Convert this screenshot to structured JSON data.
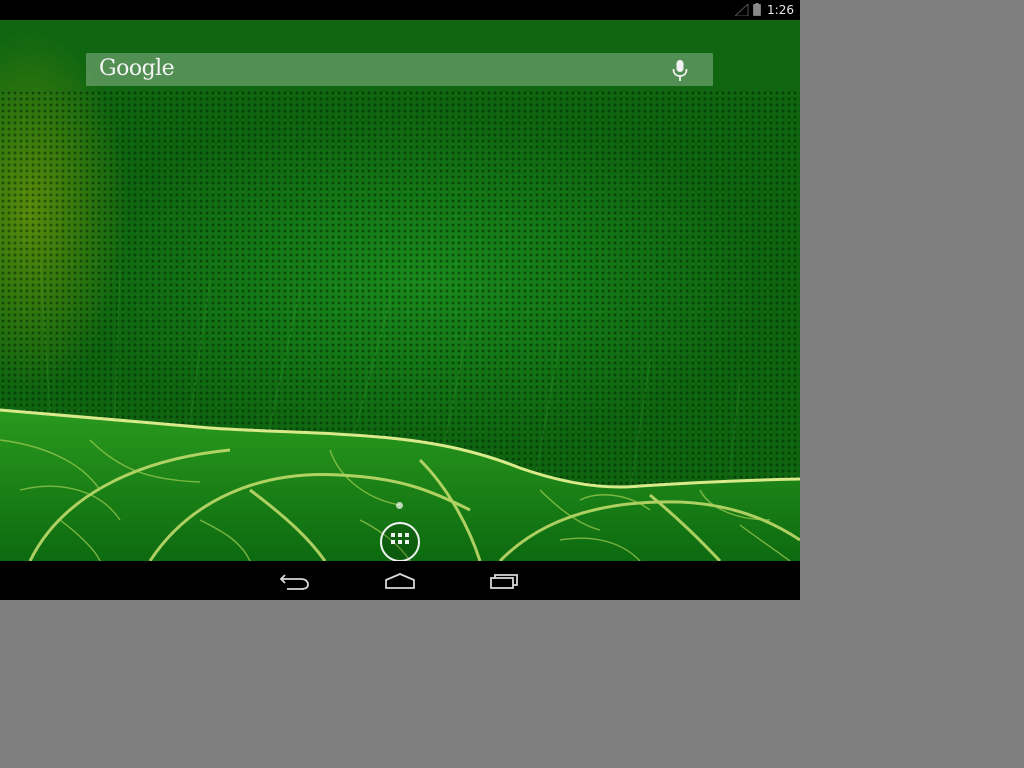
{
  "status_bar": {
    "time": "1:26",
    "icons": [
      "signal-icon",
      "battery-icon"
    ]
  },
  "search_widget": {
    "logo_text": "Google",
    "icons": [
      "mic-icon"
    ]
  },
  "home": {
    "page_indicator": "1",
    "app_drawer_icon": "all-apps-icon"
  },
  "nav_bar": {
    "icons": [
      "back-icon",
      "home-icon",
      "recents-icon"
    ]
  },
  "colors": {
    "wallpaper_green": "#137a15",
    "leaf_vein": "#c9e070",
    "outside_background": "#7f7f7f",
    "bars": "#000000"
  }
}
